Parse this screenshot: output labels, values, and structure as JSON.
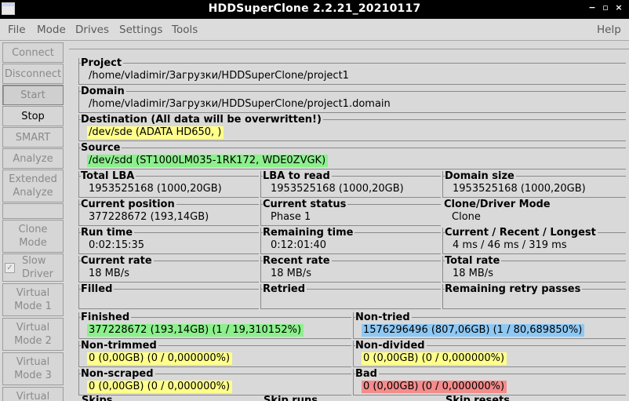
{
  "window": {
    "title": "HDDSuperClone 2.2.21_20210117",
    "min_glyph": "−",
    "max_glyph": "▫",
    "close_glyph": "×"
  },
  "menu": {
    "file": "File",
    "mode": "Mode",
    "drives": "Drives",
    "settings": "Settings",
    "tools": "Tools",
    "help": "Help"
  },
  "sidebar": {
    "connect": "Connect",
    "disconnect": "Disconnect",
    "start": "Start",
    "stop": "Stop",
    "smart": "SMART",
    "analyze": "Analyze",
    "extended_analyze_1": "Extended",
    "extended_analyze_2": "Analyze",
    "clone_mode_1": "Clone",
    "clone_mode_2": "Mode",
    "slow_driver_1": "Slow",
    "slow_driver_2": "Driver",
    "slow_driver_check": "✓",
    "vm1_1": "Virtual",
    "vm1_2": "Mode 1",
    "vm2_1": "Virtual",
    "vm2_2": "Mode 2",
    "vm3_1": "Virtual",
    "vm3_2": "Mode 3",
    "vm4_1": "Virtual"
  },
  "fields": {
    "project": {
      "label": "Project",
      "value": "/home/vladimir/Загрузки/HDDSuperClone/project1"
    },
    "domain": {
      "label": "Domain",
      "value": "/home/vladimir/Загрузки/HDDSuperClone/project1.domain"
    },
    "destination": {
      "label": "Destination (All data will be overwritten!)",
      "value": "/dev/sde (ADATA   HD650, )"
    },
    "source": {
      "label": "Source",
      "value": "/dev/sdd (ST1000LM035-1RK172, WDE0ZVGK)"
    },
    "total_lba": {
      "label": "Total LBA",
      "value": "1953525168 (1000,20GB)"
    },
    "lba_to_read": {
      "label": "LBA to read",
      "value": "1953525168 (1000,20GB)"
    },
    "domain_size": {
      "label": "Domain size",
      "value": "1953525168 (1000,20GB)"
    },
    "current_position": {
      "label": "Current position",
      "value": "377228672 (193,14GB)"
    },
    "current_status": {
      "label": "Current status",
      "value": "Phase 1"
    },
    "clone_driver_mode": {
      "label": "Clone/Driver Mode",
      "value": "Clone"
    },
    "run_time": {
      "label": "Run time",
      "value": "0:02:15:35"
    },
    "remaining_time": {
      "label": "Remaining time",
      "value": "0:12:01:40"
    },
    "cur_recent_longest": {
      "label": "Current / Recent / Longest",
      "value": "4 ms / 46 ms / 319 ms"
    },
    "current_rate": {
      "label": "Current rate",
      "value": "18 MB/s"
    },
    "recent_rate": {
      "label": "Recent rate",
      "value": "18 MB/s"
    },
    "total_rate": {
      "label": "Total rate",
      "value": "18 MB/s"
    },
    "filled": {
      "label": "Filled",
      "value": ""
    },
    "retried": {
      "label": "Retried",
      "value": ""
    },
    "remaining_retry": {
      "label": "Remaining retry passes",
      "value": ""
    },
    "finished": {
      "label": "Finished",
      "value": "377228672 (193,14GB) (1 / 19,310152%)"
    },
    "non_tried": {
      "label": "Non-tried",
      "value": "1576296496 (807,06GB) (1 / 80,689850%)"
    },
    "non_trimmed": {
      "label": "Non-trimmed",
      "value": "0 (0,00GB) (0 / 0,000000%)"
    },
    "non_divided": {
      "label": "Non-divided",
      "value": "0 (0,00GB) (0 / 0,000000%)"
    },
    "non_scraped": {
      "label": "Non-scraped",
      "value": "0 (0,00GB) (0 / 0,000000%)"
    },
    "bad": {
      "label": "Bad",
      "value": "0 (0,00GB) (0 / 0,000000%)"
    }
  },
  "bottom_labels": {
    "skips": "Skips",
    "skip_runs": "Skip runs",
    "skip_resets": "Skip resets"
  },
  "colors": {
    "highlight_yellow": "#ffff8a",
    "highlight_green": "#8cf08c",
    "highlight_blue": "#8ec8f4",
    "highlight_red": "#f48c8c"
  }
}
